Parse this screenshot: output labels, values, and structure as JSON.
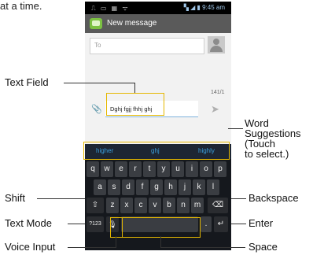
{
  "page_fragment": "at a time.",
  "status_bar": {
    "left_icons": "⎍ ▭ ▦ ᯤ",
    "right": "▚ ◢ ▮ 9:45 am"
  },
  "header": {
    "title": "New message"
  },
  "compose": {
    "to_placeholder": "To",
    "char_count": "141/1",
    "text_value": "Dghj fgjj fhhj ghj"
  },
  "suggestions": [
    "higher",
    "ghj",
    "highly"
  ],
  "keyboard": {
    "row1": [
      "q",
      "w",
      "e",
      "r",
      "t",
      "y",
      "u",
      "i",
      "o",
      "p"
    ],
    "row2": [
      "a",
      "s",
      "d",
      "f",
      "g",
      "h",
      "j",
      "k",
      "l"
    ],
    "row3": [
      "z",
      "x",
      "c",
      "v",
      "b",
      "n",
      "m"
    ],
    "shift": "⇧",
    "backspace": "⌫",
    "mode": "?123",
    "voice": "🎙",
    "period": ".",
    "enter": "↵"
  },
  "callouts": {
    "text_field": "Text Field",
    "word_suggestions_1": "Word",
    "word_suggestions_2": "Suggestions",
    "word_suggestions_3": "(Touch",
    "word_suggestions_4": "to select.)",
    "shift": "Shift",
    "backspace": "Backspace",
    "text_mode": "Text Mode",
    "enter": "Enter",
    "voice_input": "Voice Input",
    "space": "Space"
  },
  "colors": {
    "highlight": "#e5b800",
    "suggestion_text": "#3a9fdc"
  }
}
